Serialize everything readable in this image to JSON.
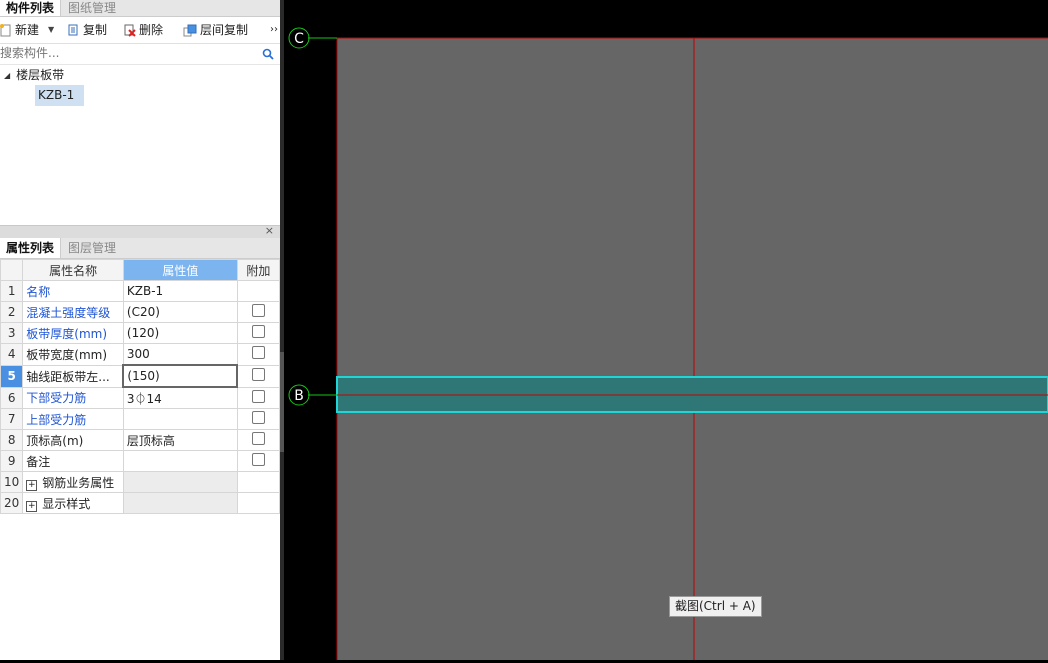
{
  "component_panel": {
    "tabs": [
      {
        "label": "构件列表"
      },
      {
        "label": "图纸管理"
      }
    ],
    "toolbar": {
      "new_label": "新建",
      "copy_label": "复制",
      "delete_label": "删除",
      "floor_copy_label": "层间复制",
      "more_glyph": "››"
    },
    "search": {
      "placeholder": "搜索构件..."
    },
    "tree": {
      "root_label": "楼层板带",
      "child_label": "KZB-1"
    }
  },
  "property_panel": {
    "close_glyph": "×",
    "tabs": [
      {
        "label": "属性列表"
      },
      {
        "label": "图层管理"
      }
    ],
    "columns": {
      "name": "属性名称",
      "value": "属性值",
      "extra": "附加"
    },
    "rows": [
      {
        "num": "1",
        "name": "名称",
        "value": "KZB-1"
      },
      {
        "num": "2",
        "name": "混凝土强度等级",
        "value": "(C20)"
      },
      {
        "num": "3",
        "name": "板带厚度(mm)",
        "value": "(120)"
      },
      {
        "num": "4",
        "name": "板带宽度(mm)",
        "value": "300"
      },
      {
        "num": "5",
        "name": "轴线距板带左...",
        "value": "(150)"
      },
      {
        "num": "6",
        "name": "下部受力筋",
        "value": "3⏀14"
      },
      {
        "num": "7",
        "name": "上部受力筋",
        "value": ""
      },
      {
        "num": "8",
        "name": "顶标高(m)",
        "value": "层顶标高"
      },
      {
        "num": "9",
        "name": "备注",
        "value": ""
      },
      {
        "num": "10",
        "name": "钢筋业务属性",
        "value": ""
      },
      {
        "num": "20",
        "name": "显示样式",
        "value": ""
      }
    ]
  },
  "canvas": {
    "axis_labels": {
      "c": "C",
      "b": "B"
    },
    "tooltip": "截图(Ctrl + A)",
    "colors": {
      "background": "#666666",
      "grid": "#c00000",
      "slab_fill": "#2f7777",
      "slab_border": "#1fd5d5",
      "axis_marker": "#19c419"
    }
  }
}
